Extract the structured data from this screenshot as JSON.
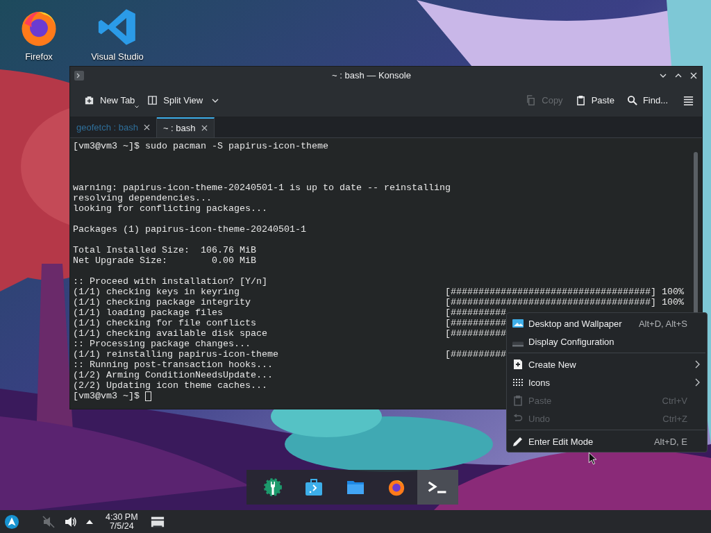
{
  "desktop_icons": [
    {
      "label": "Firefox",
      "kind": "firefox"
    },
    {
      "label": "Visual Studio",
      "kind": "vscode"
    }
  ],
  "window": {
    "title": "~ : bash — Konsole"
  },
  "toolbar": {
    "left": [
      {
        "label": "New Tab",
        "kind": "new-tab",
        "disabled": false
      },
      {
        "label": "Split View",
        "kind": "split-view",
        "disabled": false
      }
    ],
    "right": [
      {
        "label": "Copy",
        "kind": "copy",
        "disabled": true
      },
      {
        "label": "Paste",
        "kind": "paste",
        "disabled": false
      },
      {
        "label": "Find...",
        "kind": "find",
        "disabled": false
      }
    ]
  },
  "tabs": [
    {
      "label": "geofetch : bash",
      "selected": false
    },
    {
      "label": "~ : bash",
      "selected": true
    }
  ],
  "terminal": {
    "cursor": true,
    "lines": [
      {
        "text": "[vm3@vm3 ~]$ sudo pacman -S papirus-icon-theme"
      },
      {
        "kind": "blank"
      },
      {
        "kind": "blank"
      },
      {
        "kind": "blank"
      },
      {
        "text": "warning: papirus-icon-theme-20240501-1 is up to date -- reinstalling"
      },
      {
        "text": "resolving dependencies..."
      },
      {
        "text": "looking for conflicting packages..."
      },
      {
        "kind": "blank"
      },
      {
        "text": "Packages (1) papirus-icon-theme-20240501-1"
      },
      {
        "kind": "blank"
      },
      {
        "text": "Total Installed Size:  106.76 MiB"
      },
      {
        "text": "Net Upgrade Size:        0.00 MiB"
      },
      {
        "kind": "blank"
      },
      {
        "text": ":: Proceed with installation? [Y/n]"
      },
      {
        "text": "(1/1) checking keys in keyring",
        "progress": "[####################################] 100%"
      },
      {
        "text": "(1/1) checking package integrity",
        "progress": "[####################################] 100%"
      },
      {
        "text": "(1/1) loading package files",
        "progress": "[##########"
      },
      {
        "text": "(1/1) checking for file conflicts",
        "progress": "[##########"
      },
      {
        "text": "(1/1) checking available disk space",
        "progress": "[##########"
      },
      {
        "text": ":: Processing package changes..."
      },
      {
        "text": "(1/1) reinstalling papirus-icon-theme",
        "progress": "[##########"
      },
      {
        "text": ":: Running post-transaction hooks..."
      },
      {
        "text": "(1/2) Arming ConditionNeedsUpdate..."
      },
      {
        "text": "(2/2) Updating icon theme caches..."
      },
      {
        "text": "[vm3@vm3 ~]$ "
      }
    ]
  },
  "context_menu": {
    "items": [
      {
        "kind": "wallpaper",
        "label": "Desktop and Wallpaper",
        "shortcut": "Alt+D, Alt+S",
        "disabled": false,
        "submenu": false
      },
      {
        "kind": "display",
        "label": "Display Configuration",
        "disabled": false,
        "submenu": false
      },
      {
        "kind": "separator"
      },
      {
        "kind": "create",
        "label": "Create New",
        "disabled": false,
        "submenu": true
      },
      {
        "kind": "icons",
        "label": "Icons",
        "disabled": false,
        "submenu": true
      },
      {
        "kind": "paste",
        "label": "Paste",
        "shortcut": "Ctrl+V",
        "disabled": true,
        "submenu": false
      },
      {
        "kind": "undo",
        "label": "Undo",
        "shortcut": "Ctrl+Z",
        "disabled": true,
        "submenu": false
      },
      {
        "kind": "separator"
      },
      {
        "kind": "edit",
        "label": "Enter Edit Mode",
        "shortcut": "Alt+D, E",
        "disabled": false,
        "submenu": false
      }
    ]
  },
  "dock": {
    "apps": [
      {
        "kind": "settings",
        "active": false
      },
      {
        "kind": "store",
        "active": false
      },
      {
        "kind": "files",
        "active": false
      },
      {
        "kind": "firefox",
        "active": false
      },
      {
        "kind": "terminal",
        "active": true
      }
    ]
  },
  "panel": {
    "time": "4:30 PM",
    "date": "7/5/24"
  }
}
